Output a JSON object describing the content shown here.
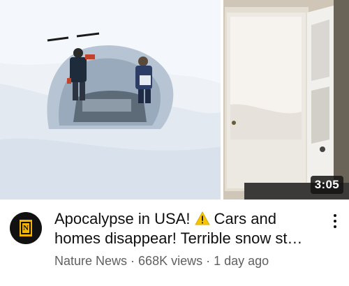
{
  "video": {
    "duration": "3:05",
    "title": "Apocalypse in USA! ⚠️ Cars and homes disappear! Terrible snow storm",
    "title_part1": "Apocalypse in USA! ",
    "title_part2": " Cars and homes disappear! Terrible snow st…",
    "channel": "Nature News",
    "views": "668K views",
    "age": "1 day ago",
    "separator": " · "
  },
  "channel_logo": {
    "letter": "N",
    "bg": "#111111",
    "accent": "#f6b400"
  },
  "icons": {
    "more": "more-vert-icon",
    "warning": "warning-icon"
  }
}
